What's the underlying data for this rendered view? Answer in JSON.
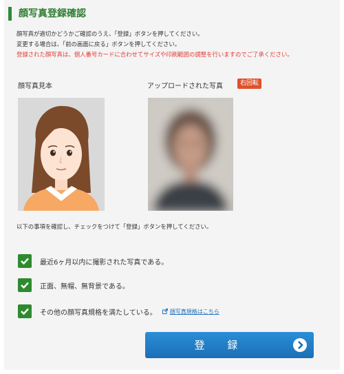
{
  "title": "顔写真登録確認",
  "intro": {
    "line1": "顔写真が適切かどうかご確認のうえ、「登録」ボタンを押してください。",
    "line2": "変更する場合は、「前の画面に戻る」ボタンを押してください。",
    "warning": "登録された顔写真は、個人番号カードに合わせてサイズや印刷範囲の調整を行いますのでご了承ください。"
  },
  "sample_label": "顔写真見本",
  "upload_label": "アップロードされた写真",
  "rotate_button": "右回転",
  "check_instruction": "以下の事項を確認し、チェックをつけて「登録」ボタンを押してください。",
  "checks": [
    {
      "label": "最近6ヶ月以内に撮影された写真である。",
      "checked": true
    },
    {
      "label": "正面、無帽、無背景である。",
      "checked": true
    },
    {
      "label": "その他の顔写真規格を満たしている。",
      "checked": true
    }
  ],
  "rule_link": "顔写真規格はこちら",
  "submit_button": "登 録",
  "colors": {
    "accent": "#2e8b3a",
    "warning": "#e53935",
    "button": "#1a7cc8",
    "rotate": "#e0512b"
  }
}
